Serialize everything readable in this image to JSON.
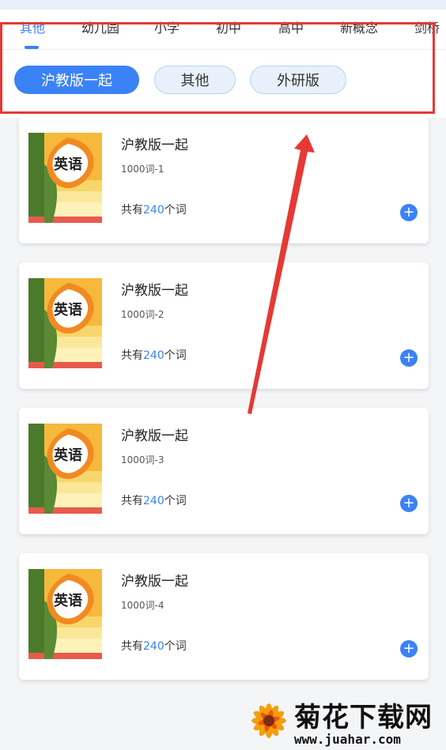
{
  "tabs": [
    "其他",
    "幼儿园",
    "小学",
    "初中",
    "高中",
    "新概念",
    "剑桥"
  ],
  "active_tab": "其他",
  "filters": [
    {
      "label": "沪教版一起",
      "active": true
    },
    {
      "label": "其他",
      "active": false
    },
    {
      "label": "外研版",
      "active": false
    }
  ],
  "cards": [
    {
      "title": "沪教版一起",
      "subtitle": "1000词-1",
      "count_prefix": "共有",
      "count": "240",
      "count_suffix": "个词",
      "cover_text": "英语"
    },
    {
      "title": "沪教版一起",
      "subtitle": "1000词-2",
      "count_prefix": "共有",
      "count": "240",
      "count_suffix": "个词",
      "cover_text": "英语"
    },
    {
      "title": "沪教版一起",
      "subtitle": "1000词-3",
      "count_prefix": "共有",
      "count": "240",
      "count_suffix": "个词",
      "cover_text": "英语"
    },
    {
      "title": "沪教版一起",
      "subtitle": "1000词-4",
      "count_prefix": "共有",
      "count": "240",
      "count_suffix": "个词",
      "cover_text": "英语"
    }
  ],
  "add_icon": "plus-icon",
  "watermark": {
    "text": "菊花下载网",
    "url": "www.juahar.com"
  },
  "colors": {
    "accent": "#3b82f6",
    "annotation": "#e53935"
  }
}
